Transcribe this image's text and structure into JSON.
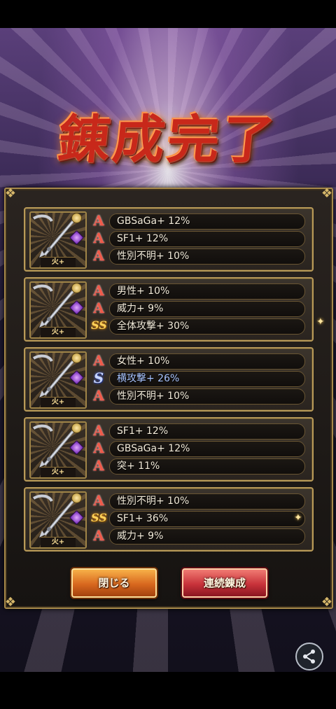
{
  "title": "錬成完了",
  "cards": [
    {
      "element": "火+",
      "rows": [
        {
          "rank": "A",
          "text": "GBSaGa+ 12%",
          "blue": false
        },
        {
          "rank": "A",
          "text": "SF1+ 12%",
          "blue": false
        },
        {
          "rank": "A",
          "text": "性別不明+ 10%",
          "blue": false
        }
      ]
    },
    {
      "element": "火+",
      "rows": [
        {
          "rank": "A",
          "text": "男性+ 10%",
          "blue": false
        },
        {
          "rank": "A",
          "text": "威力+ 9%",
          "blue": false
        },
        {
          "rank": "SS",
          "text": "全体攻撃+ 30%",
          "blue": false
        }
      ]
    },
    {
      "element": "火+",
      "rows": [
        {
          "rank": "A",
          "text": "女性+ 10%",
          "blue": false
        },
        {
          "rank": "S",
          "text": "横攻撃+ 26%",
          "blue": true
        },
        {
          "rank": "A",
          "text": "性別不明+ 10%",
          "blue": false
        }
      ]
    },
    {
      "element": "火+",
      "rows": [
        {
          "rank": "A",
          "text": "SF1+ 12%",
          "blue": false
        },
        {
          "rank": "A",
          "text": "GBSaGa+ 12%",
          "blue": false
        },
        {
          "rank": "A",
          "text": "突+ 11%",
          "blue": false
        }
      ]
    },
    {
      "element": "火+",
      "rows": [
        {
          "rank": "A",
          "text": "性別不明+ 10%",
          "blue": false
        },
        {
          "rank": "SS",
          "text": "SF1+ 36%",
          "blue": false
        },
        {
          "rank": "A",
          "text": "威力+ 9%",
          "blue": false
        }
      ]
    }
  ],
  "buttons": {
    "close": "閉じる",
    "continue": "連続錬成"
  },
  "icons": {
    "share": "share-icon",
    "weapon": "spear-weapon-icon"
  },
  "colors": {
    "accent": "#b89a58",
    "close_button": "#e07a24",
    "continue_button": "#c8323a"
  }
}
